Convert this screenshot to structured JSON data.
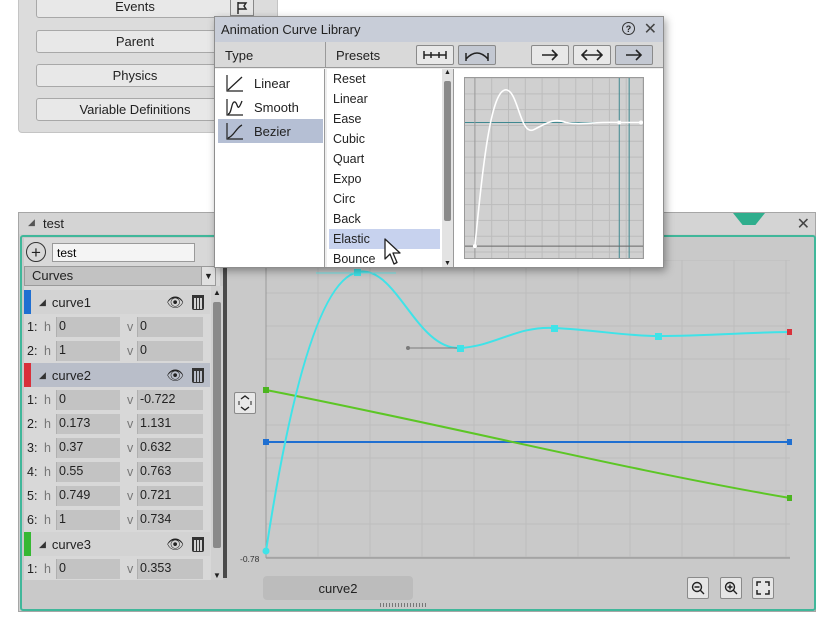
{
  "property_panel": {
    "buttons": [
      "Events",
      "Parent",
      "Physics",
      "Variable Definitions"
    ]
  },
  "editor": {
    "title": "test",
    "name_input_value": "test",
    "list_selector": "Curves",
    "curves": [
      {
        "name": "curve1",
        "color": "#1f6fd1",
        "points": [
          {
            "idx": "1:",
            "h": "0",
            "v": "0"
          },
          {
            "idx": "2:",
            "h": "1",
            "v": "0"
          }
        ]
      },
      {
        "name": "curve2",
        "color": "#d9303a",
        "points": [
          {
            "idx": "1:",
            "h": "0",
            "v": "-0.722"
          },
          {
            "idx": "2:",
            "h": "0.173",
            "v": "1.131"
          },
          {
            "idx": "3:",
            "h": "0.37",
            "v": "0.632"
          },
          {
            "idx": "4:",
            "h": "0.55",
            "v": "0.763"
          },
          {
            "idx": "5:",
            "h": "0.749",
            "v": "0.721"
          },
          {
            "idx": "6:",
            "h": "1",
            "v": "0.734"
          }
        ]
      },
      {
        "name": "curve3",
        "color": "#36b833",
        "points": [
          {
            "idx": "1:",
            "h": "0",
            "v": "0.353"
          }
        ]
      }
    ],
    "h_label": "h",
    "v_label": "v",
    "graph": {
      "y_min_label": "-0.78",
      "selected_curve": "curve2"
    }
  },
  "dialog": {
    "title": "Animation Curve Library",
    "type_header": "Type",
    "presets_header": "Presets",
    "types": [
      "Linear",
      "Smooth",
      "Bezier"
    ],
    "selected_type": "Bezier",
    "presets": [
      "Reset",
      "Linear",
      "Ease",
      "Cubic",
      "Quart",
      "Expo",
      "Circ",
      "Back",
      "Elastic",
      "Bounce"
    ],
    "selected_preset": "Elastic"
  },
  "colors": {
    "accent_teal": "#40b79a",
    "curve_cyan": "#3fe3e8",
    "curve_green": "#5cc625",
    "curve_blue": "#1f6fd1",
    "selection": "#b5bfd4"
  },
  "icons": [
    "flag-icon",
    "close-icon",
    "add-icon",
    "chevron-down-icon",
    "eye-icon",
    "trash-icon",
    "help-icon",
    "fit-vertical-icon",
    "zoom-out-icon",
    "zoom-in-icon",
    "fullscreen-icon",
    "arrow-right-icon",
    "arrow-both-icon",
    "linear-icon",
    "smooth-icon",
    "bezier-icon",
    "mouse-cursor-icon"
  ]
}
